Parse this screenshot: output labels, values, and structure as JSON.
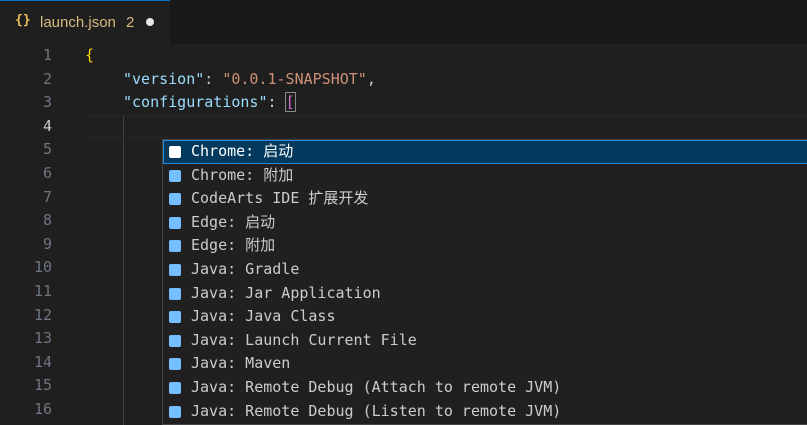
{
  "tab": {
    "icon": "{}",
    "filename": "launch.json",
    "problems_badge": "2",
    "unsaved_dot": "modified-dot-icon"
  },
  "editor": {
    "lines": [
      {
        "number": "1",
        "brace": "{"
      },
      {
        "number": "2",
        "key": "\"version\"",
        "colon": ": ",
        "value": "\"0.0.1-SNAPSHOT\"",
        "comma": ","
      },
      {
        "number": "3",
        "key": "\"configurations\"",
        "colon": ": ",
        "bracket": "["
      },
      {
        "number": "4"
      },
      {
        "number": "5"
      },
      {
        "number": "6"
      },
      {
        "number": "7"
      },
      {
        "number": "8"
      },
      {
        "number": "9"
      },
      {
        "number": "10"
      },
      {
        "number": "11"
      },
      {
        "number": "12"
      },
      {
        "number": "13"
      },
      {
        "number": "14"
      },
      {
        "number": "15"
      },
      {
        "number": "16"
      }
    ],
    "active_line": "4"
  },
  "suggest": {
    "icon": "snippet-icon",
    "selected_index": 0,
    "items": [
      {
        "label": "Chrome: 启动"
      },
      {
        "label": "Chrome: 附加"
      },
      {
        "label": "CodeArts IDE 扩展开发"
      },
      {
        "label": "Edge: 启动"
      },
      {
        "label": "Edge: 附加"
      },
      {
        "label": "Java: Gradle"
      },
      {
        "label": "Java: Jar Application"
      },
      {
        "label": "Java: Java Class"
      },
      {
        "label": "Java: Launch Current File"
      },
      {
        "label": "Java: Maven"
      },
      {
        "label": "Java: Remote Debug (Attach to remote JVM)"
      },
      {
        "label": "Java: Remote Debug (Listen to remote JVM)"
      }
    ]
  },
  "colors": {
    "tab_text": "#d7ba7d",
    "selected_bg": "#04395e",
    "icon_blue": "#75beff"
  }
}
